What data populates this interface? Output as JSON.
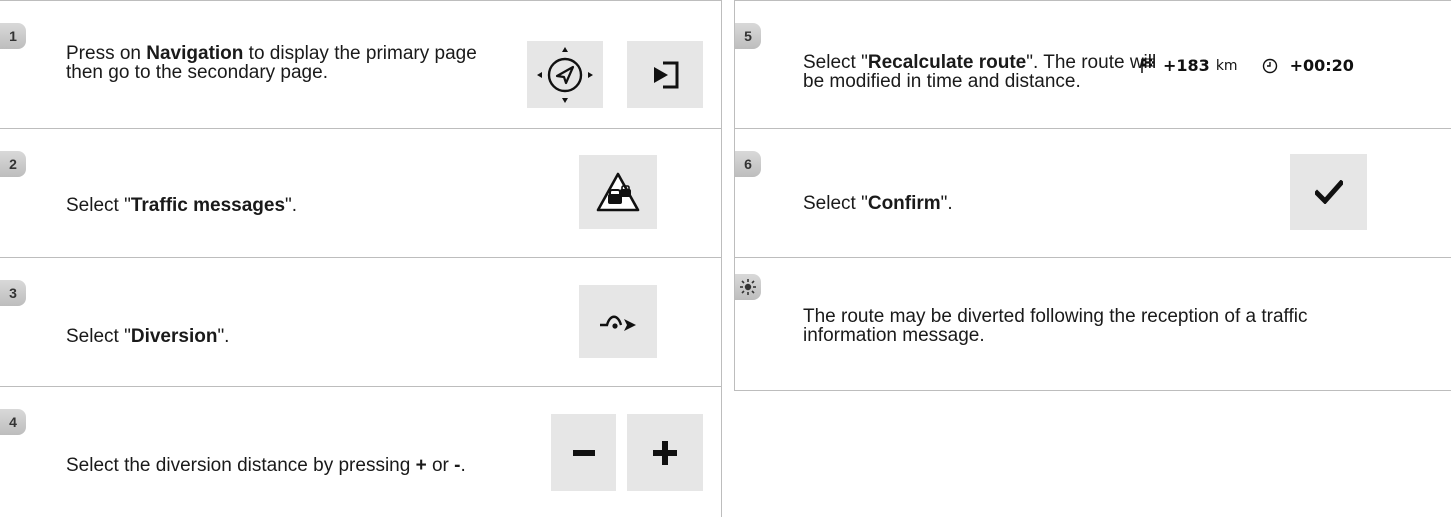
{
  "steps": {
    "s1": {
      "num": "1",
      "pre": "Press on ",
      "bold": "Navigation",
      "post": " to display the primary page then go to the secondary page."
    },
    "s2": {
      "num": "2",
      "pre": "Select \"",
      "bold": "Traffic messages",
      "post": "\"."
    },
    "s3": {
      "num": "3",
      "pre": "Select \"",
      "bold": "Diversion",
      "post": "\"."
    },
    "s4": {
      "num": "4",
      "pre": "Select the diversion distance by pressing ",
      "bold_plus": "+",
      "mid": " or ",
      "bold_minus": "-",
      "post": "."
    },
    "s5": {
      "num": "5",
      "pre": "Select \"",
      "bold": "Recalculate route",
      "post": "\". The route will be modified in time and distance."
    },
    "s6": {
      "num": "6",
      "pre": "Select \"",
      "bold": "Confirm",
      "post": "\"."
    },
    "tip": {
      "text": "The route may be diverted following the reception of a traffic information message."
    }
  },
  "route_readout": {
    "distance": "+183",
    "distance_unit": "km",
    "time": "+00:20"
  },
  "icons": {
    "navigation": "navigation-compass-icon",
    "secondary_page": "secondary-page-icon",
    "traffic": "traffic-warning-icon",
    "diversion": "diversion-icon",
    "minus": "minus-icon",
    "plus": "plus-icon",
    "flag": "checkered-flag-icon",
    "clock": "clock-icon",
    "confirm": "checkmark-icon",
    "tip": "lightbulb-icon"
  },
  "colors": {
    "tile": "#e6e6e6",
    "divider": "#bdbdbd",
    "badge": "#cccccc"
  }
}
